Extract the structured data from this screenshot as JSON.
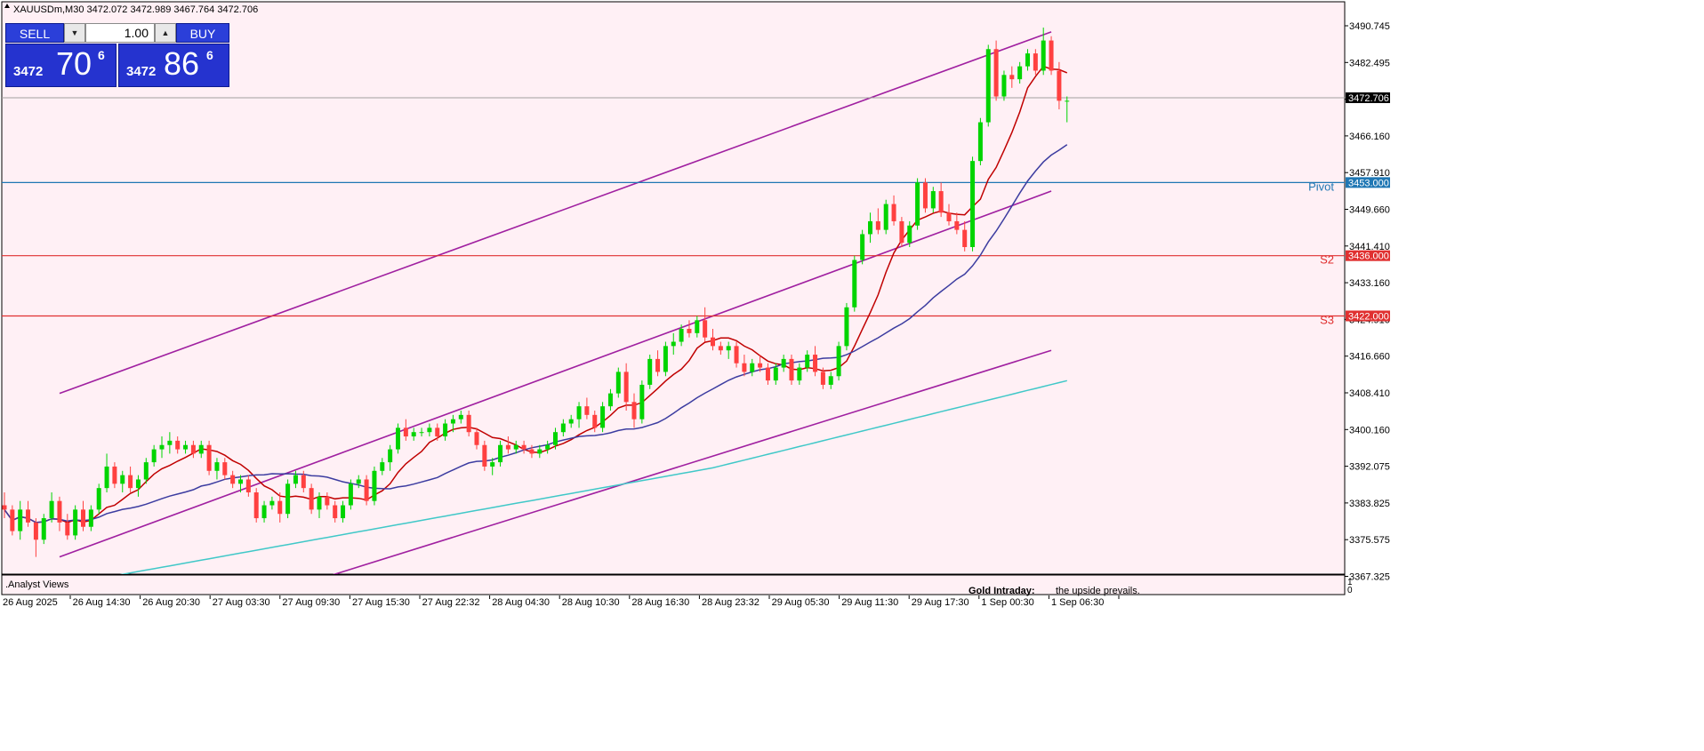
{
  "header": {
    "symbol_info": "XAUUSDm,M30  3472.072 3472.989 3467.764 3472.706"
  },
  "trade_panel": {
    "sell_label": "SELL",
    "buy_label": "BUY",
    "lot_value": "1.00",
    "sell_price": {
      "small": "3472",
      "big": "70",
      "sup": "6"
    },
    "buy_price": {
      "small": "3472",
      "big": "86",
      "sup": "6"
    }
  },
  "price_axis": {
    "labels": [
      "3490.745",
      "3482.495",
      "3474.245",
      "3466.160",
      "3457.910",
      "3449.660",
      "3441.410",
      "3433.160",
      "3424.910",
      "3416.660",
      "3408.410",
      "3400.160",
      "3392.075",
      "3383.825",
      "3375.575",
      "3367.325"
    ],
    "current_price": "3472.706"
  },
  "levels": [
    {
      "name": "Pivot",
      "value": "3453.000",
      "color": "#1f77b4"
    },
    {
      "name": "S2",
      "value": "3436.000",
      "color": "#e03030"
    },
    {
      "name": "S3",
      "value": "3422.000",
      "color": "#e03030"
    }
  ],
  "time_axis": [
    "26 Aug 2025",
    "26 Aug 14:30",
    "26 Aug 20:30",
    "27 Aug 03:30",
    "27 Aug 09:30",
    "27 Aug 15:30",
    "27 Aug 22:32",
    "28 Aug 04:30",
    "28 Aug 10:30",
    "28 Aug 16:30",
    "28 Aug 23:32",
    "29 Aug 05:30",
    "29 Aug 11:30",
    "29 Aug 17:30",
    "1 Sep 00:30",
    "1 Sep 06:30"
  ],
  "indicator_window": {
    "title": ".Analyst Views",
    "text_bold": "Gold Intraday:",
    "text": "the upside prevails.",
    "scale_top": "1",
    "scale_bottom": "0"
  },
  "colors": {
    "background": "#fff0f5",
    "bull": "#00d400",
    "bear": "#ff4040",
    "channel": "#a020a0",
    "ma_fast": "#c00000",
    "ma_mid": "#3c3ca0",
    "ma_slow": "#40c8c8"
  },
  "chart_data": {
    "type": "candlestick",
    "ylim": [
      3362,
      3495
    ],
    "candles": [
      [
        3378,
        3381,
        3375,
        3377
      ],
      [
        3377,
        3378,
        3371,
        3372
      ],
      [
        3372,
        3379,
        3370,
        3377
      ],
      [
        3377,
        3379,
        3373,
        3374
      ],
      [
        3374,
        3375,
        3366,
        3370
      ],
      [
        3370,
        3376,
        3369,
        3375
      ],
      [
        3375,
        3381,
        3374,
        3379
      ],
      [
        3379,
        3380,
        3372,
        3374
      ],
      [
        3374,
        3376,
        3370,
        3371
      ],
      [
        3371,
        3378,
        3370,
        3377
      ],
      [
        3377,
        3379,
        3372,
        3373
      ],
      [
        3373,
        3378,
        3372,
        3377
      ],
      [
        3377,
        3383,
        3376,
        3382
      ],
      [
        3382,
        3390,
        3381,
        3387
      ],
      [
        3387,
        3388,
        3382,
        3383
      ],
      [
        3383,
        3386,
        3381,
        3385
      ],
      [
        3385,
        3387,
        3381,
        3382
      ],
      [
        3382,
        3385,
        3380,
        3384
      ],
      [
        3384,
        3389,
        3383,
        3388
      ],
      [
        3388,
        3392,
        3387,
        3391
      ],
      [
        3391,
        3394,
        3389,
        3392
      ],
      [
        3392,
        3395,
        3390,
        3393
      ],
      [
        3393,
        3394,
        3390,
        3391
      ],
      [
        3391,
        3393,
        3390,
        3392
      ],
      [
        3392,
        3393,
        3389,
        3390
      ],
      [
        3390,
        3393,
        3389,
        3392
      ],
      [
        3392,
        3393,
        3385,
        3386
      ],
      [
        3386,
        3389,
        3384,
        3388
      ],
      [
        3388,
        3389,
        3384,
        3385
      ],
      [
        3385,
        3386,
        3382,
        3383
      ],
      [
        3383,
        3385,
        3381,
        3384
      ],
      [
        3384,
        3385,
        3380,
        3381
      ],
      [
        3381,
        3382,
        3374,
        3375
      ],
      [
        3375,
        3379,
        3374,
        3378
      ],
      [
        3378,
        3380,
        3377,
        3379
      ],
      [
        3379,
        3381,
        3374,
        3376
      ],
      [
        3376,
        3384,
        3375,
        3383
      ],
      [
        3383,
        3386,
        3382,
        3385
      ],
      [
        3385,
        3386,
        3381,
        3382
      ],
      [
        3382,
        3383,
        3376,
        3377
      ],
      [
        3377,
        3381,
        3375,
        3380
      ],
      [
        3380,
        3381,
        3377,
        3378
      ],
      [
        3378,
        3379,
        3374,
        3375
      ],
      [
        3375,
        3379,
        3374,
        3378
      ],
      [
        3378,
        3384,
        3377,
        3383
      ],
      [
        3383,
        3385,
        3382,
        3384
      ],
      [
        3384,
        3385,
        3378,
        3379
      ],
      [
        3379,
        3387,
        3378,
        3386
      ],
      [
        3386,
        3389,
        3385,
        3388
      ],
      [
        3388,
        3392,
        3386,
        3391
      ],
      [
        3391,
        3397,
        3390,
        3396
      ],
      [
        3396,
        3398,
        3393,
        3394
      ],
      [
        3394,
        3396,
        3393,
        3395
      ],
      [
        3395,
        3396,
        3394,
        3395
      ],
      [
        3395,
        3397,
        3394,
        3396
      ],
      [
        3396,
        3397,
        3393,
        3394
      ],
      [
        3394,
        3398,
        3393,
        3397
      ],
      [
        3397,
        3399,
        3395,
        3398
      ],
      [
        3398,
        3400,
        3397,
        3399
      ],
      [
        3399,
        3400,
        3394,
        3395
      ],
      [
        3395,
        3396,
        3391,
        3392
      ],
      [
        3392,
        3393,
        3386,
        3387
      ],
      [
        3387,
        3389,
        3385,
        3388
      ],
      [
        3388,
        3393,
        3387,
        3392
      ],
      [
        3392,
        3394,
        3390,
        3391
      ],
      [
        3391,
        3393,
        3390,
        3392
      ],
      [
        3392,
        3393,
        3390,
        3391
      ],
      [
        3391,
        3392,
        3389,
        3390
      ],
      [
        3390,
        3392,
        3389,
        3391
      ],
      [
        3391,
        3393,
        3390,
        3392
      ],
      [
        3392,
        3396,
        3391,
        3395
      ],
      [
        3395,
        3398,
        3394,
        3397
      ],
      [
        3397,
        3399,
        3396,
        3398
      ],
      [
        3398,
        3402,
        3396,
        3401
      ],
      [
        3401,
        3403,
        3398,
        3399
      ],
      [
        3399,
        3400,
        3395,
        3396
      ],
      [
        3396,
        3402,
        3395,
        3401
      ],
      [
        3401,
        3405,
        3400,
        3404
      ],
      [
        3404,
        3410,
        3403,
        3409
      ],
      [
        3409,
        3411,
        3400,
        3402
      ],
      [
        3402,
        3404,
        3396,
        3398
      ],
      [
        3398,
        3407,
        3397,
        3406
      ],
      [
        3406,
        3413,
        3405,
        3412
      ],
      [
        3412,
        3414,
        3408,
        3409
      ],
      [
        3409,
        3416,
        3408,
        3415
      ],
      [
        3415,
        3418,
        3413,
        3416
      ],
      [
        3416,
        3420,
        3415,
        3419
      ],
      [
        3419,
        3421,
        3417,
        3418
      ],
      [
        3418,
        3422,
        3417,
        3421
      ],
      [
        3421,
        3424,
        3416,
        3417
      ],
      [
        3417,
        3419,
        3414,
        3415
      ],
      [
        3415,
        3416,
        3413,
        3414
      ],
      [
        3414,
        3416,
        3412,
        3415
      ],
      [
        3415,
        3416,
        3410,
        3411
      ],
      [
        3411,
        3413,
        3408,
        3409
      ],
      [
        3409,
        3412,
        3408,
        3411
      ],
      [
        3411,
        3413,
        3409,
        3410
      ],
      [
        3410,
        3411,
        3406,
        3407
      ],
      [
        3407,
        3411,
        3406,
        3410
      ],
      [
        3410,
        3413,
        3409,
        3412
      ],
      [
        3412,
        3413,
        3406,
        3407
      ],
      [
        3407,
        3411,
        3406,
        3410
      ],
      [
        3410,
        3414,
        3409,
        3413
      ],
      [
        3413,
        3415,
        3408,
        3409
      ],
      [
        3409,
        3410,
        3405,
        3406
      ],
      [
        3406,
        3409,
        3405,
        3408
      ],
      [
        3408,
        3416,
        3407,
        3415
      ],
      [
        3415,
        3425,
        3414,
        3424
      ],
      [
        3424,
        3436,
        3423,
        3435
      ],
      [
        3435,
        3442,
        3434,
        3441
      ],
      [
        3441,
        3446,
        3439,
        3444
      ],
      [
        3444,
        3447,
        3441,
        3442
      ],
      [
        3442,
        3449,
        3441,
        3448
      ],
      [
        3448,
        3450,
        3443,
        3444
      ],
      [
        3444,
        3445,
        3438,
        3439
      ],
      [
        3439,
        3444,
        3438,
        3443
      ],
      [
        3443,
        3454,
        3442,
        3453
      ],
      [
        3453,
        3454,
        3446,
        3447
      ],
      [
        3447,
        3452,
        3446,
        3451
      ],
      [
        3451,
        3453,
        3445,
        3446
      ],
      [
        3446,
        3448,
        3443,
        3444
      ],
      [
        3444,
        3446,
        3441,
        3442
      ],
      [
        3442,
        3444,
        3437,
        3438
      ],
      [
        3438,
        3459,
        3437,
        3458
      ],
      [
        3458,
        3468,
        3457,
        3467
      ],
      [
        3467,
        3485,
        3466,
        3484
      ],
      [
        3484,
        3486,
        3472,
        3473
      ],
      [
        3473,
        3479,
        3472,
        3478
      ],
      [
        3478,
        3480,
        3475,
        3477
      ],
      [
        3477,
        3481,
        3476,
        3480
      ],
      [
        3480,
        3484,
        3479,
        3483
      ],
      [
        3483,
        3484,
        3478,
        3479
      ],
      [
        3479,
        3489,
        3478,
        3486
      ],
      [
        3486,
        3487,
        3478,
        3479
      ],
      [
        3479,
        3481,
        3470,
        3472
      ],
      [
        3472,
        3473,
        3467,
        3472
      ]
    ]
  }
}
